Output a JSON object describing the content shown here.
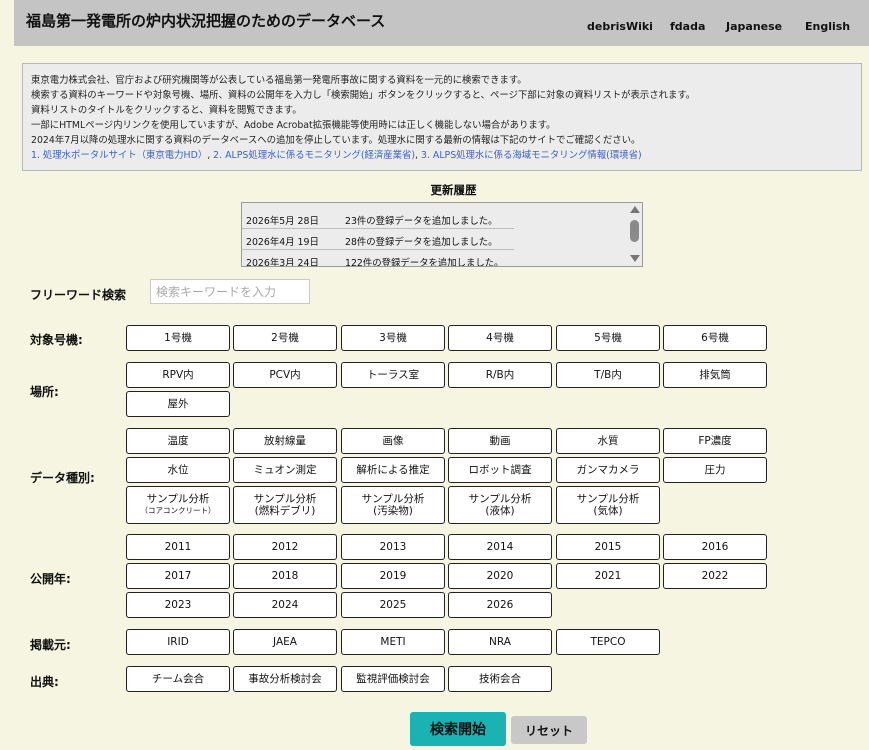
{
  "header": {
    "title": "福島第一発電所の炉内状況把握のためのデータベース",
    "nav": [
      "debrisWiki",
      "fdada",
      "Japanese",
      "English"
    ]
  },
  "info": {
    "lines": [
      "東京電力株式会社、官庁および研究機関等が公表している福島第一発電所事故に関する資料を一元的に検索できます。",
      "検索する資料のキーワードや対象号機、場所、資料の公開年を入力し「検索開始」ボタンをクリックすると、ページ下部に対象の資料リストが表示されます。",
      "資料リストのタイトルをクリックすると、資料を閲覧できます。",
      "一部にHTMLページ内リンクを使用していますが、Adobe Acrobat拡張機能等使用時には正しく機能しない場合があります。",
      "2024年7月以降の処理水に関する資料のデータベースへの追加を停止しています。処理水に関する最新の情報は下記のサイトでご確認ください。"
    ],
    "links": [
      "1. 処理水ポータルサイト（東京電力HD）",
      "2. ALPS処理水に係るモニタリング(経済産業省)",
      "3. ALPS処理水に係る海域モニタリング情報(環境省)"
    ],
    "separator": ","
  },
  "history": {
    "title": "更新履歴",
    "rows": [
      {
        "date": "2026年5月 28日",
        "msg": "23件の登録データを追加しました。"
      },
      {
        "date": "2026年4月 19日",
        "msg": "28件の登録データを追加しました。"
      },
      {
        "date": "2026年3月 24日",
        "msg": "122件の登録データを追加しました。"
      }
    ]
  },
  "search": {
    "label": "フリーワード検索",
    "placeholder": "検索キーワードを入力"
  },
  "units": {
    "label": "対象号機:",
    "options": [
      "1号機",
      "2号機",
      "3号機",
      "4号機",
      "5号機",
      "6号機"
    ]
  },
  "location": {
    "label": "場所:",
    "options": [
      "RPV内",
      "PCV内",
      "トーラス室",
      "R/B内",
      "T/B内",
      "排気筒",
      "屋外"
    ]
  },
  "datatype": {
    "label": "データ種別:",
    "options": [
      "温度",
      "放射線量",
      "画像",
      "動画",
      "水質",
      "FP濃度",
      "水位",
      "ミュオン測定",
      "解析による推定",
      "ロボット調査",
      "ガンマカメラ",
      "圧力"
    ],
    "samples": [
      {
        "main": "サンプル分析",
        "sub": "（コアコンクリート）"
      },
      {
        "main": "サンプル分析",
        "sub": "(燃料デブリ)"
      },
      {
        "main": "サンプル分析",
        "sub": "(汚染物)"
      },
      {
        "main": "サンプル分析",
        "sub": "(液体)"
      },
      {
        "main": "サンプル分析",
        "sub": "(気体)"
      }
    ]
  },
  "year": {
    "label": "公開年:",
    "options": [
      "2011",
      "2012",
      "2013",
      "2014",
      "2015",
      "2016",
      "2017",
      "2018",
      "2019",
      "2020",
      "2021",
      "2022",
      "2023",
      "2024",
      "2025",
      "2026"
    ]
  },
  "publisher": {
    "label": "掲載元:",
    "options": [
      "IRID",
      "JAEA",
      "METI",
      "NRA",
      "TEPCO"
    ]
  },
  "source": {
    "label": "出典:",
    "options": [
      "チーム会合",
      "事故分析検討会",
      "監視評価検討会",
      "技術会合"
    ]
  },
  "actions": {
    "search": "検索開始",
    "reset": "リセット"
  }
}
